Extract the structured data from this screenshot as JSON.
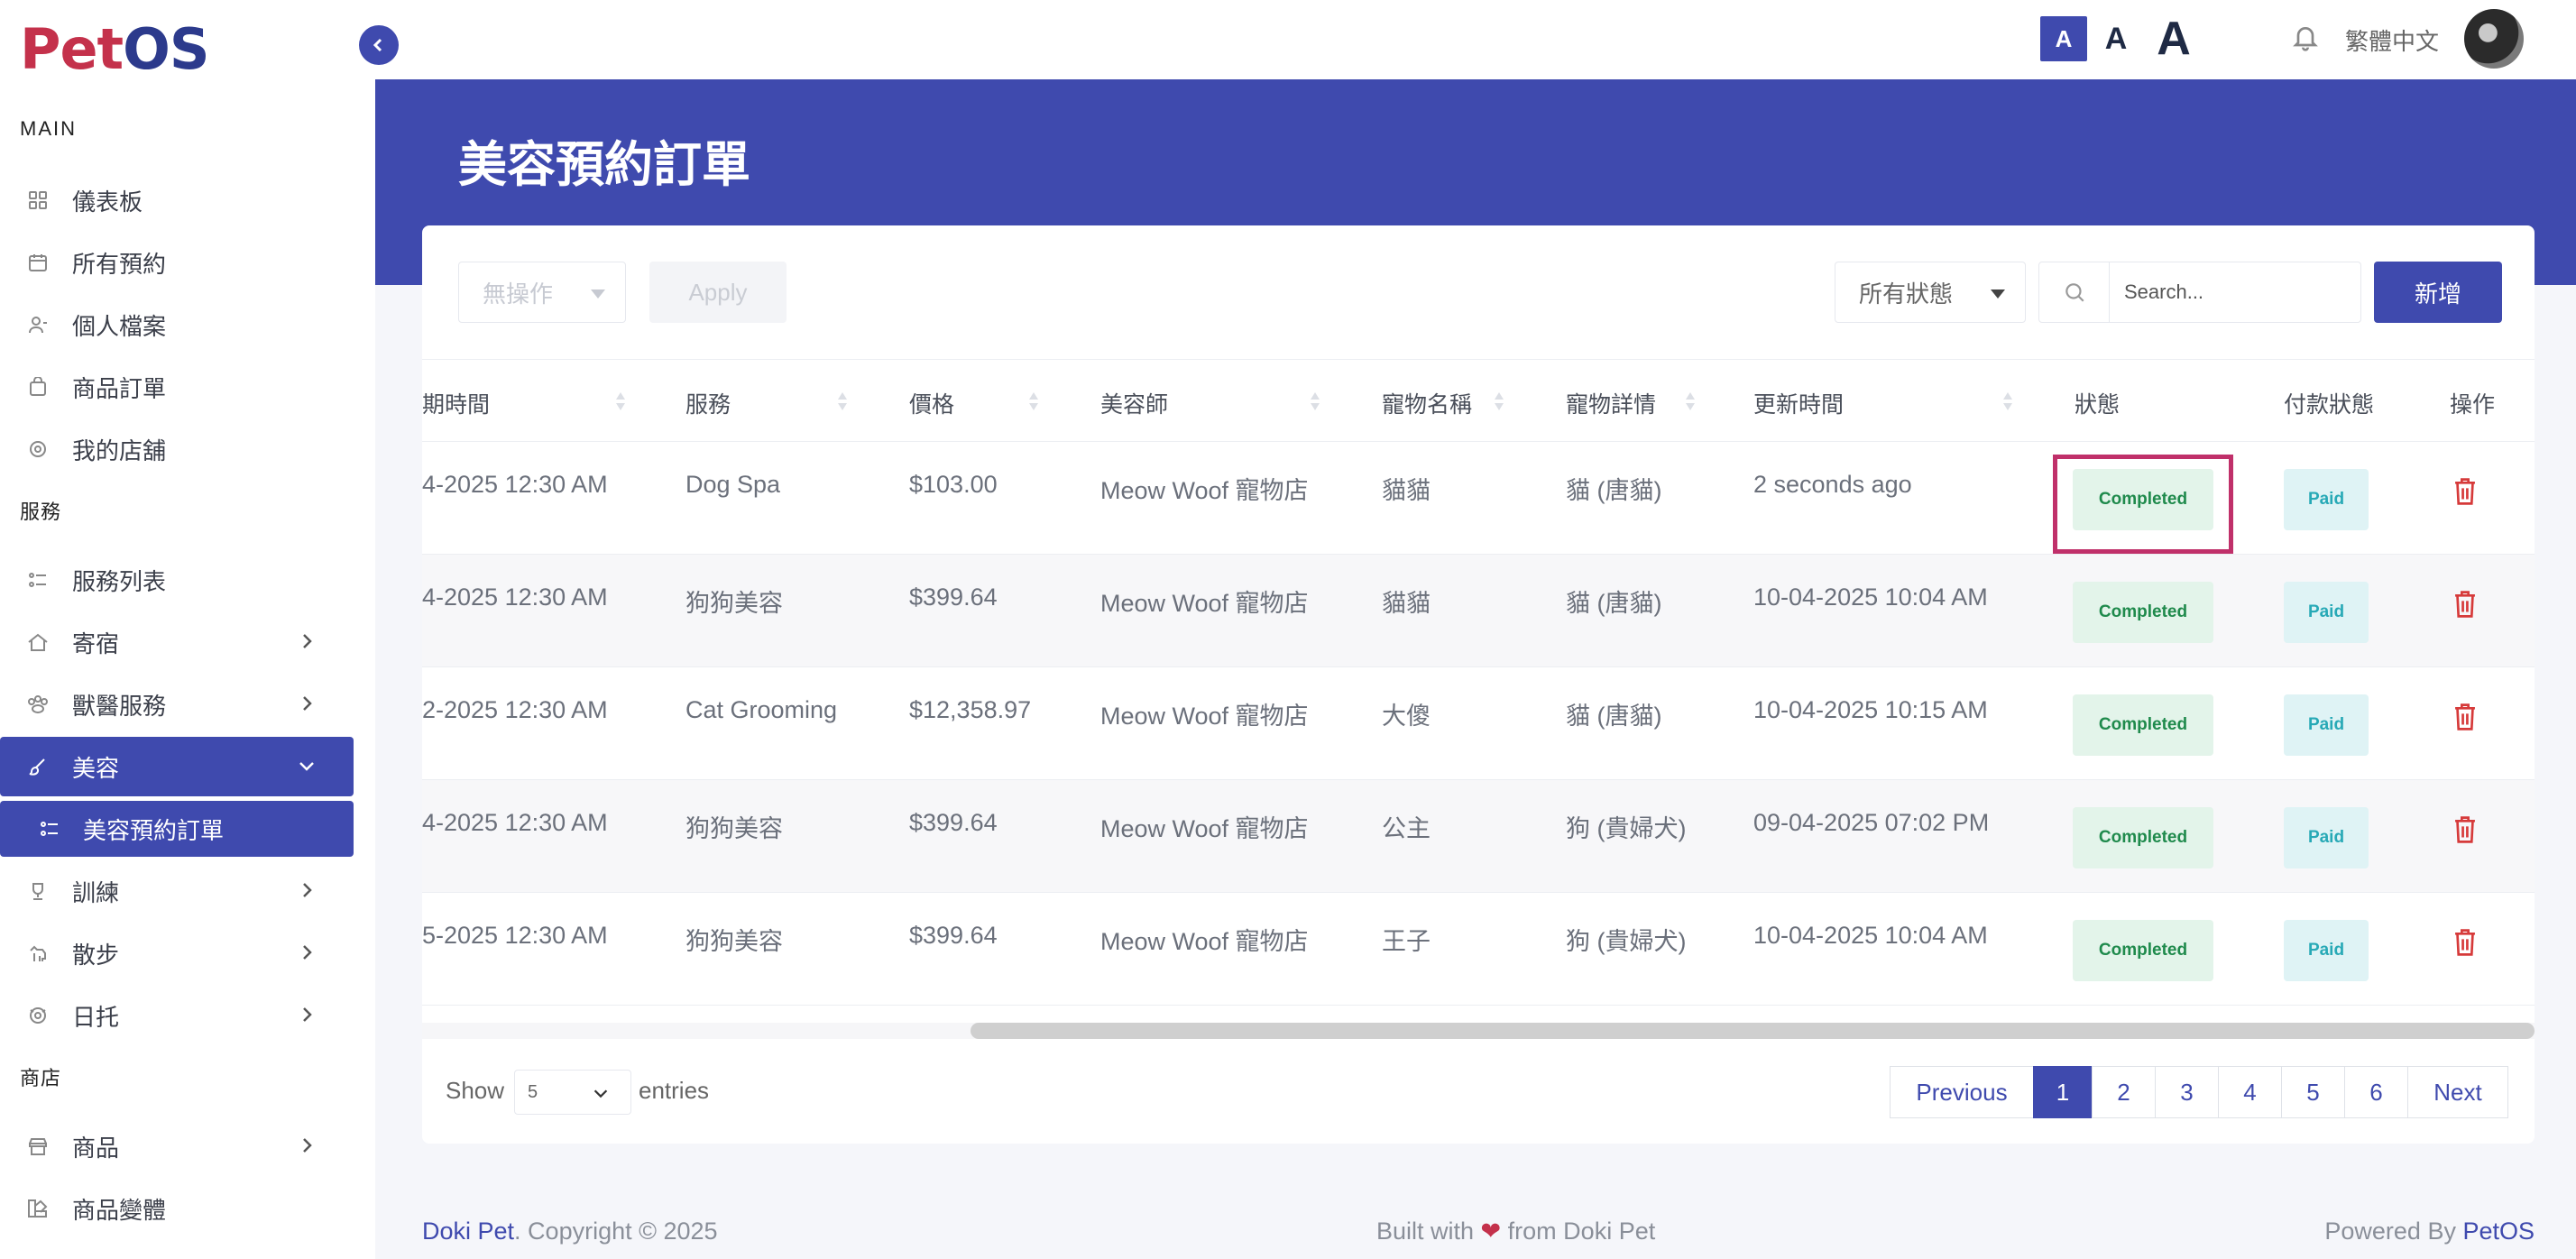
{
  "brand": {
    "logo_a": "Pet",
    "logo_b": "OS"
  },
  "sidebar": {
    "main_label": "MAIN",
    "main_items": [
      {
        "label": "儀表板",
        "icon": "grid-icon"
      },
      {
        "label": "所有預約",
        "icon": "calendar-icon"
      },
      {
        "label": "個人檔案",
        "icon": "user-icon"
      },
      {
        "label": "商品訂單",
        "icon": "bag-icon"
      },
      {
        "label": "我的店舖",
        "icon": "store-icon"
      }
    ],
    "service_label": "服務",
    "service_items": [
      {
        "label": "服務列表",
        "icon": "list-icon"
      },
      {
        "label": "寄宿",
        "icon": "house-icon"
      },
      {
        "label": "獸醫服務",
        "icon": "vet-icon"
      },
      {
        "label": "美容",
        "icon": "brush-icon"
      },
      {
        "label": "美容預約訂單",
        "icon": "list-icon"
      },
      {
        "label": "訓練",
        "icon": "trophy-icon"
      },
      {
        "label": "散步",
        "icon": "dog-icon"
      },
      {
        "label": "日托",
        "icon": "paw-icon"
      }
    ],
    "shop_label": "商店",
    "shop_items": [
      {
        "label": "商品",
        "icon": "shop-icon"
      },
      {
        "label": "商品變體",
        "icon": "variant-icon"
      }
    ]
  },
  "topbar": {
    "font_small": "A",
    "font_medium": "A",
    "font_large": "A",
    "language": "繁體中文"
  },
  "page": {
    "title": "美容預約訂單"
  },
  "toolbar": {
    "bulk_action": "無操作",
    "apply": "Apply",
    "status_filter": "所有狀態",
    "search_placeholder": "Search...",
    "new_button": "新增"
  },
  "table": {
    "columns": [
      "期時間",
      "服務",
      "價格",
      "美容師",
      "寵物名稱",
      "寵物詳情",
      "更新時間",
      "狀態",
      "付款狀態",
      "操作"
    ],
    "rows": [
      {
        "time": "4-2025 12:30 AM",
        "service": "Dog Spa",
        "price": "$103.00",
        "groomer": "Meow Woof 寵物店",
        "pet": "貓貓",
        "detail": "貓 (唐貓)",
        "updated": "2 seconds ago",
        "status": "Completed",
        "payment": "Paid"
      },
      {
        "time": "4-2025 12:30 AM",
        "service": "狗狗美容",
        "price": "$399.64",
        "groomer": "Meow Woof 寵物店",
        "pet": "貓貓",
        "detail": "貓 (唐貓)",
        "updated": "10-04-2025 10:04 AM",
        "status": "Completed",
        "payment": "Paid"
      },
      {
        "time": "2-2025 12:30 AM",
        "service": "Cat Grooming",
        "price": "$12,358.97",
        "groomer": "Meow Woof 寵物店",
        "pet": "大傻",
        "detail": "貓 (唐貓)",
        "updated": "10-04-2025 10:15 AM",
        "status": "Completed",
        "payment": "Paid"
      },
      {
        "time": "4-2025 12:30 AM",
        "service": "狗狗美容",
        "price": "$399.64",
        "groomer": "Meow Woof 寵物店",
        "pet": "公主",
        "detail": "狗 (貴婦犬)",
        "updated": "09-04-2025 07:02 PM",
        "status": "Completed",
        "payment": "Paid"
      },
      {
        "time": "5-2025 12:30 AM",
        "service": "狗狗美容",
        "price": "$399.64",
        "groomer": "Meow Woof 寵物店",
        "pet": "王子",
        "detail": "狗 (貴婦犬)",
        "updated": "10-04-2025 10:04 AM",
        "status": "Completed",
        "payment": "Paid"
      }
    ]
  },
  "pagination": {
    "show": "Show",
    "entries_value": "5",
    "entries": "entries",
    "previous": "Previous",
    "pages": [
      "1",
      "2",
      "3",
      "4",
      "5",
      "6"
    ],
    "next": "Next",
    "current": "1"
  },
  "footer": {
    "brand": "Doki Pet",
    "copyright": ". Copyright © 2025",
    "built_prefix": "Built with ",
    "built_suffix": " from Doki Pet",
    "powered_prefix": "Powered By ",
    "powered_brand": "PetOS"
  },
  "colors": {
    "primary": "#3f4aae",
    "logo_red": "#c4314b",
    "highlight": "#c0306a",
    "success": "#1f8a4c",
    "info": "#27a9b6",
    "danger": "#d63a3a"
  }
}
